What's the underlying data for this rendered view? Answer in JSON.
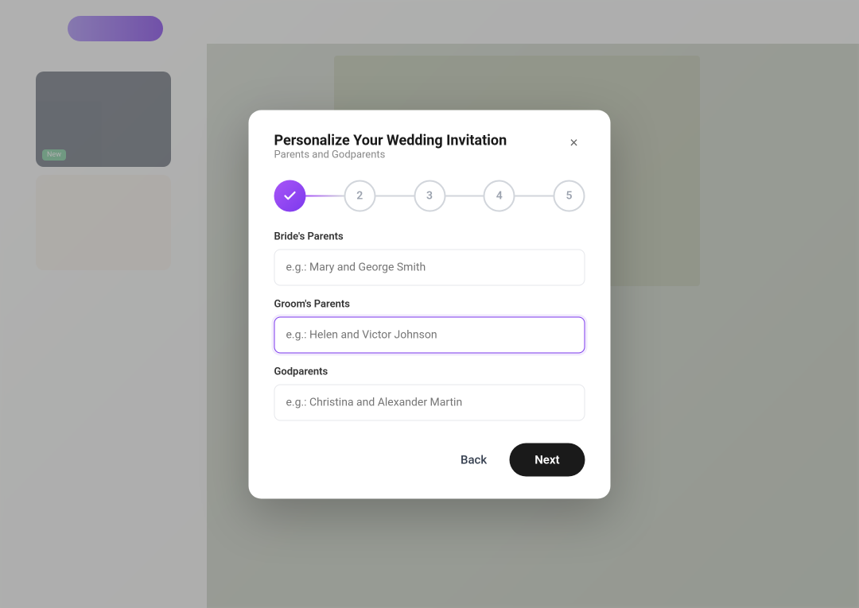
{
  "background": {
    "color": "#dde2d9"
  },
  "modal": {
    "title": "Personalize Your Wedding Invitation",
    "subtitle": "Parents and Godparents",
    "close_label": "×",
    "steps": [
      {
        "id": 1,
        "label": "✓",
        "state": "active"
      },
      {
        "id": 2,
        "label": "2",
        "state": "inactive"
      },
      {
        "id": 3,
        "label": "3",
        "state": "inactive"
      },
      {
        "id": 4,
        "label": "4",
        "state": "inactive"
      },
      {
        "id": 5,
        "label": "5",
        "state": "inactive"
      }
    ],
    "fields": [
      {
        "id": "brides-parents",
        "label": "Bride's Parents",
        "placeholder": "e.g.: Mary and George Smith"
      },
      {
        "id": "grooms-parents",
        "label": "Groom's Parents",
        "placeholder": "e.g.: Helen and Victor Johnson",
        "focused": true
      },
      {
        "id": "godparents",
        "label": "Godparents",
        "placeholder": "e.g.: Christina and Alexander Martin"
      }
    ],
    "buttons": {
      "back_label": "Back",
      "next_label": "Next"
    }
  }
}
